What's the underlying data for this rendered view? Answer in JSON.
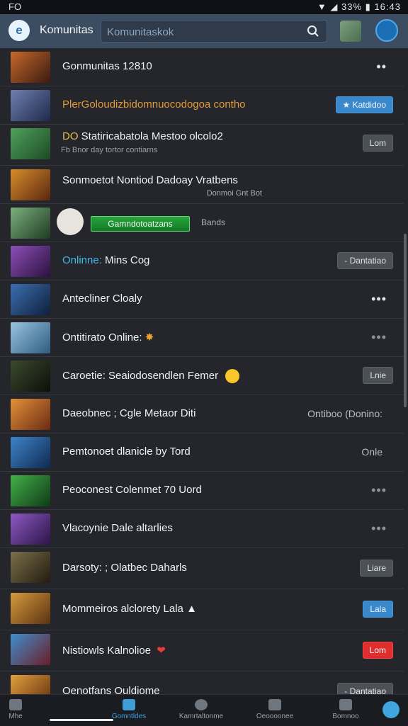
{
  "status_bar": {
    "left": "FO",
    "time": "16:43",
    "battery": "33%"
  },
  "app_bar": {
    "logo": "e",
    "title": "Komunitas",
    "search_placeholder": "Komunitaskok"
  },
  "rows": [
    {
      "title": "Gonmunitas 12810",
      "action": "more"
    },
    {
      "title": "PlerGoloudizbidomnuocodogoa contho",
      "button": "Katdidoo"
    },
    {
      "title": "Statiricabatola Mestoo olcolo2",
      "prefix": "DO",
      "subtitle": "Fb Bnor day tortor contiarns",
      "button": "Lom"
    },
    {
      "title": "Sonmoetot Nontiod Dadoay Vratbens",
      "meta": "Donmoi Gnt Bot"
    },
    {
      "badge": "Gamndotoatzans",
      "hint": "Bands"
    },
    {
      "title": "Mins Cog",
      "prefix": "Onlinne:",
      "button": "Dantatiao"
    },
    {
      "title": "Antecliner Cloaly",
      "action": "more"
    },
    {
      "title": "Ontitirato Online:",
      "action": "more-dim"
    },
    {
      "title": "Caroetie: Seaiodosendlen Femer",
      "button": "Lnie"
    },
    {
      "title": "Daeobnec ; Cgle Metaor Diti",
      "status": "Ontiboo (Donino:"
    },
    {
      "title": "Pemtonoet dlanicle by Tord",
      "status": "Onle"
    },
    {
      "title": "Peoconest Colenmet 70 Uord",
      "action": "more-dim"
    },
    {
      "title": "Vlacoynie Dale altarlies",
      "action": "more-dim"
    },
    {
      "title": "Darsoty: ; Olatbec Daharls",
      "button": "Liare"
    },
    {
      "title": "Mommeiros alclorety Lala",
      "button": "Lala"
    },
    {
      "title": "Nistiowls Kalnolioe",
      "button": "Lom"
    },
    {
      "title": "Oenotfans Ouldiome",
      "button": "Dantatiao"
    }
  ],
  "bottom_nav": [
    {
      "label": "Mhe"
    },
    {
      "label": "Gomntldes"
    },
    {
      "label": "Kamrtaltonme"
    },
    {
      "label": "Oeoooonee"
    },
    {
      "label": "Bomnoo"
    }
  ],
  "colors": {
    "background": "#24262b",
    "app_bar": "#3c4d62",
    "accent": "#3a88cc",
    "badge_green": "#1a8f30",
    "alert_red": "#e02e2e"
  }
}
